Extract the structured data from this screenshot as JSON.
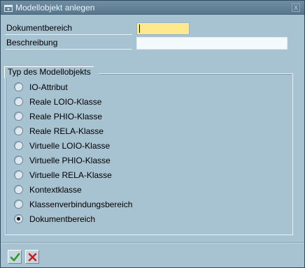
{
  "window": {
    "title": "Modellobjekt anlegen",
    "close_label": "X"
  },
  "fields": {
    "dokumentbereich": {
      "label": "Dokumentbereich",
      "value": ""
    },
    "beschreibung": {
      "label": "Beschreibung",
      "value": ""
    }
  },
  "group": {
    "title": "Typ des Modellobjekts",
    "options": [
      {
        "label": "IO-Attribut",
        "checked": false
      },
      {
        "label": "Reale LOIO-Klasse",
        "checked": false
      },
      {
        "label": "Reale PHIO-Klasse",
        "checked": false
      },
      {
        "label": "Reale RELA-Klasse",
        "checked": false
      },
      {
        "label": "Virtuelle LOIO-Klasse",
        "checked": false
      },
      {
        "label": "Virtuelle PHIO-Klasse",
        "checked": false
      },
      {
        "label": "Virtuelle RELA-Klasse",
        "checked": false
      },
      {
        "label": "Kontextklasse",
        "checked": false
      },
      {
        "label": "Klassenverbindungsbereich",
        "checked": false
      },
      {
        "label": "Dokumentbereich",
        "checked": true
      }
    ]
  },
  "footer": {
    "confirm_icon": "check-icon",
    "cancel_icon": "cancel-x-icon"
  },
  "colors": {
    "required_field": "#ffe98f",
    "confirm": "#2e9a1e",
    "cancel": "#d21c1c"
  }
}
